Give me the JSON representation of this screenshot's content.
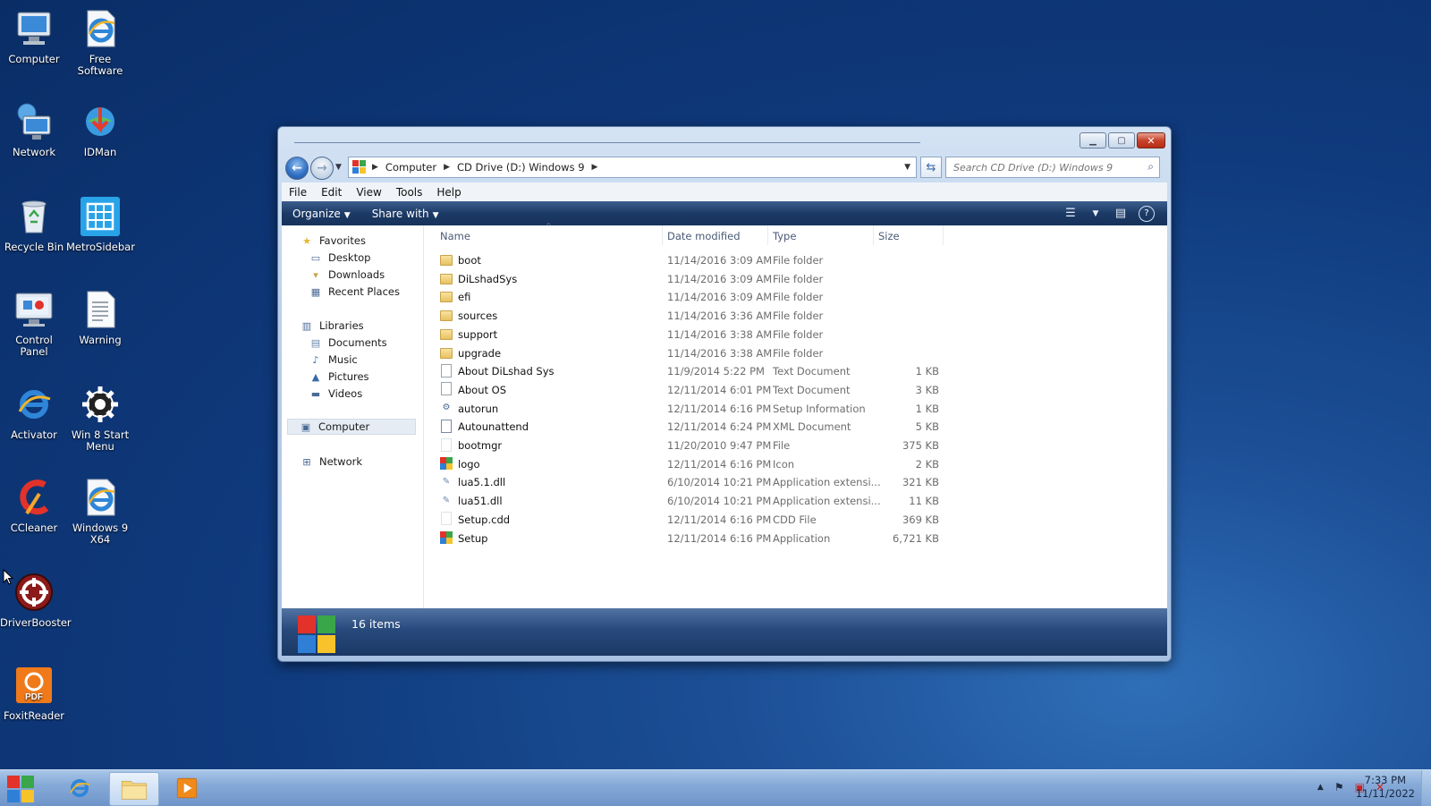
{
  "desktop": {
    "icons": [
      {
        "label": "Computer",
        "icon": "computer-icon"
      },
      {
        "label": "Free Software",
        "icon": "internet-explorer-icon"
      },
      {
        "label": "Network",
        "icon": "network-icon"
      },
      {
        "label": "IDMan",
        "icon": "idman-icon"
      },
      {
        "label": "Recycle Bin",
        "icon": "recycle-bin-icon"
      },
      {
        "label": "MetroSidebar",
        "icon": "metro-sidebar-icon"
      },
      {
        "label": "Control Panel",
        "icon": "control-panel-icon"
      },
      {
        "label": "Warning",
        "icon": "text-file-icon"
      },
      {
        "label": "Activator",
        "icon": "internet-explorer-icon"
      },
      {
        "label": "Win 8 Start Menu",
        "icon": "gear-icon"
      },
      {
        "label": "CCleaner",
        "icon": "ccleaner-icon"
      },
      {
        "label": "Windows 9 X64",
        "icon": "internet-explorer-icon"
      },
      {
        "label": "DriverBooster",
        "icon": "driverbooster-icon"
      },
      {
        "label": "FoxitReader",
        "icon": "pdf-icon"
      }
    ]
  },
  "explorer": {
    "address": {
      "crumbs": [
        "Computer",
        "CD Drive (D:) Windows 9"
      ]
    },
    "search": {
      "placeholder": "Search CD Drive (D:) Windows 9"
    },
    "menu": [
      "File",
      "Edit",
      "View",
      "Tools",
      "Help"
    ],
    "commands": {
      "organize": "Organize",
      "share_with": "Share with"
    },
    "nav": {
      "favorites": "Favorites",
      "favorite_items": [
        "Desktop",
        "Downloads",
        "Recent Places"
      ],
      "libraries": "Libraries",
      "library_items": [
        "Documents",
        "Music",
        "Pictures",
        "Videos"
      ],
      "computer": "Computer",
      "network": "Network"
    },
    "columns": {
      "name": "Name",
      "date": "Date modified",
      "type": "Type",
      "size": "Size"
    },
    "files": [
      {
        "name": "boot",
        "date": "11/14/2016 3:09 AM",
        "type": "File folder",
        "size": "",
        "icon": "folder"
      },
      {
        "name": "DiLshadSys",
        "date": "11/14/2016 3:09 AM",
        "type": "File folder",
        "size": "",
        "icon": "folder"
      },
      {
        "name": "efi",
        "date": "11/14/2016 3:09 AM",
        "type": "File folder",
        "size": "",
        "icon": "folder"
      },
      {
        "name": "sources",
        "date": "11/14/2016 3:36 AM",
        "type": "File folder",
        "size": "",
        "icon": "folder"
      },
      {
        "name": "support",
        "date": "11/14/2016 3:38 AM",
        "type": "File folder",
        "size": "",
        "icon": "folder"
      },
      {
        "name": "upgrade",
        "date": "11/14/2016 3:38 AM",
        "type": "File folder",
        "size": "",
        "icon": "folder"
      },
      {
        "name": "About DiLshad Sys",
        "date": "11/9/2014 5:22 PM",
        "type": "Text Document",
        "size": "1 KB",
        "icon": "doc"
      },
      {
        "name": "About OS",
        "date": "12/11/2014 6:01 PM",
        "type": "Text Document",
        "size": "3 KB",
        "icon": "doc"
      },
      {
        "name": "autorun",
        "date": "12/11/2014 6:16 PM",
        "type": "Setup Information",
        "size": "1 KB",
        "icon": "gear"
      },
      {
        "name": "Autounattend",
        "date": "12/11/2014 6:24 PM",
        "type": "XML Document",
        "size": "5 KB",
        "icon": "xml"
      },
      {
        "name": "bootmgr",
        "date": "11/20/2010 9:47 PM",
        "type": "File",
        "size": "375 KB",
        "icon": "blank"
      },
      {
        "name": "logo",
        "date": "12/11/2014 6:16 PM",
        "type": "Icon",
        "size": "2 KB",
        "icon": "win"
      },
      {
        "name": "lua5.1.dll",
        "date": "6/10/2014 10:21 PM",
        "type": "Application extensi...",
        "size": "321 KB",
        "icon": "dll"
      },
      {
        "name": "lua51.dll",
        "date": "6/10/2014 10:21 PM",
        "type": "Application extensi...",
        "size": "11 KB",
        "icon": "dll"
      },
      {
        "name": "Setup.cdd",
        "date": "12/11/2014 6:16 PM",
        "type": "CDD File",
        "size": "369 KB",
        "icon": "blank"
      },
      {
        "name": "Setup",
        "date": "12/11/2014 6:16 PM",
        "type": "Application",
        "size": "6,721 KB",
        "icon": "win"
      }
    ],
    "status": {
      "count": "16 items"
    }
  },
  "taskbar": {
    "clock_time": "7:33 PM",
    "clock_date": "11/11/2022"
  },
  "colors": {
    "win_red": "#e2322a",
    "win_green": "#3aa64a",
    "win_blue": "#2f7fd6",
    "win_yellow": "#f6c42a"
  }
}
